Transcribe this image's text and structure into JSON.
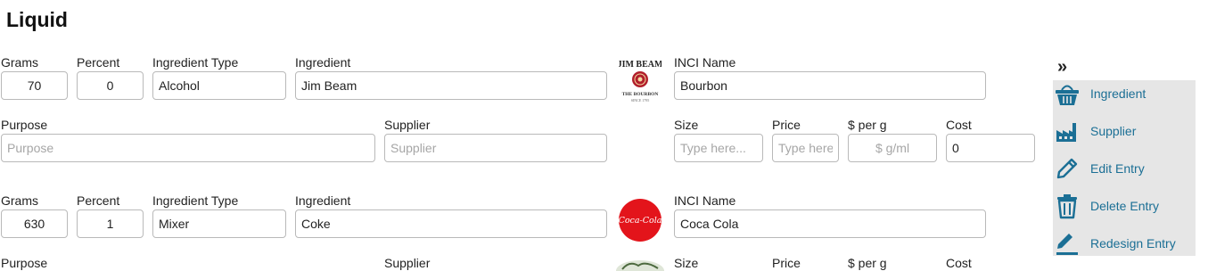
{
  "title": "Liquid",
  "labels": {
    "grams": "Grams",
    "percent": "Percent",
    "ingredient_type": "Ingredient Type",
    "ingredient": "Ingredient",
    "inci_name": "INCI Name",
    "purpose": "Purpose",
    "supplier": "Supplier",
    "size": "Size",
    "price": "Price",
    "per_g": "$ per g",
    "cost": "Cost"
  },
  "placeholders": {
    "purpose": "Purpose",
    "supplier": "Supplier",
    "size": "Type here...",
    "price": "Type here...",
    "per_g": "$ g/ml"
  },
  "rows": [
    {
      "grams": "70",
      "percent": "0",
      "ingredient_type": "Alcohol",
      "ingredient": "Jim Beam",
      "inci_name": "Bourbon",
      "cost": "0",
      "logo": {
        "line1": "JIM BEAM",
        "line2": "THE BOURBON",
        "line3": "SINCE 1795"
      }
    },
    {
      "grams": "630",
      "percent": "1",
      "ingredient_type": "Mixer",
      "ingredient": "Coke",
      "inci_name": "Coca Cola",
      "logo": {
        "text": "Coca-Cola"
      }
    }
  ],
  "sidebar": {
    "toggle": "»",
    "items": [
      {
        "label": "Ingredient",
        "icon": "basket-icon"
      },
      {
        "label": "Supplier",
        "icon": "factory-icon"
      },
      {
        "label": "Edit Entry",
        "icon": "pencil-icon"
      },
      {
        "label": "Delete Entry",
        "icon": "trash-icon"
      },
      {
        "label": "Redesign Entry",
        "icon": "redesign-icon"
      }
    ],
    "icon_color": "#1b6f95",
    "panel_color": "#e6e6e6"
  }
}
